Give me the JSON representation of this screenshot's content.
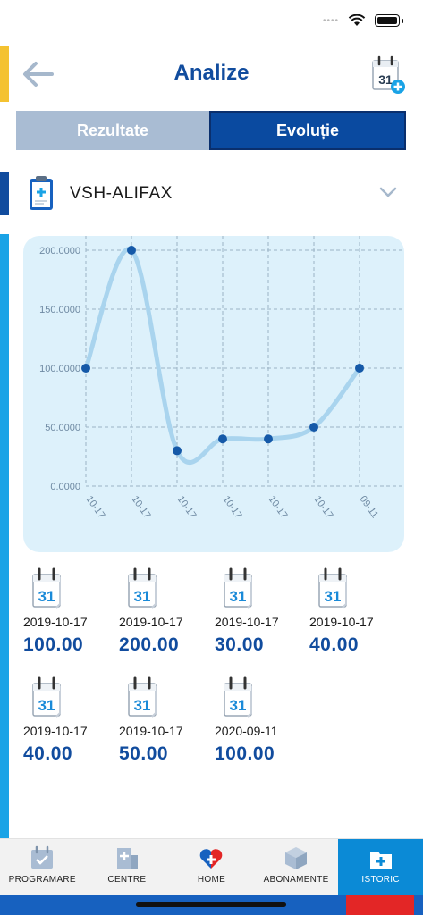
{
  "header": {
    "title": "Analize"
  },
  "tabs": [
    {
      "label": "Rezultate",
      "active": false
    },
    {
      "label": "Evoluție",
      "active": true
    }
  ],
  "test": {
    "name": "VSH-ALIFAX"
  },
  "chart_data": {
    "type": "line",
    "x": [
      "10-17",
      "10-17",
      "10-17",
      "10-17",
      "10-17",
      "10-17",
      "09-11"
    ],
    "series": [
      {
        "values": [
          100,
          200,
          30,
          40,
          40,
          50,
          100
        ]
      }
    ],
    "yticks": [
      "200.0000",
      "150.0000",
      "100.0000",
      "50.0000",
      "0.0000"
    ],
    "ylim": [
      0,
      200
    ],
    "grid": true,
    "line_color": "#a9d4ee",
    "point_color": "#1559a8"
  },
  "entries": [
    {
      "date": "2019-10-17",
      "value": "100.00"
    },
    {
      "date": "2019-10-17",
      "value": "200.00"
    },
    {
      "date": "2019-10-17",
      "value": "30.00"
    },
    {
      "date": "2019-10-17",
      "value": "40.00"
    },
    {
      "date": "2019-10-17",
      "value": "40.00"
    },
    {
      "date": "2019-10-17",
      "value": "50.00"
    },
    {
      "date": "2020-09-11",
      "value": "100.00"
    }
  ],
  "nav": [
    {
      "label": "PROGRAMARE",
      "icon": "calendar-check-icon"
    },
    {
      "label": "CENTRE",
      "icon": "hospital-icon"
    },
    {
      "label": "HOME",
      "icon": "heart-icon"
    },
    {
      "label": "ABONAMENTE",
      "icon": "box-icon"
    },
    {
      "label": "ISTORIC",
      "icon": "medical-folder-icon",
      "active": true
    }
  ],
  "calendar_icon_text": "31",
  "colors": {
    "brand_blue": "#114c9e",
    "accent_yellow": "#f4c231",
    "accent_cyan": "#1aa3e6",
    "nav_active": "#0b8ad6"
  }
}
